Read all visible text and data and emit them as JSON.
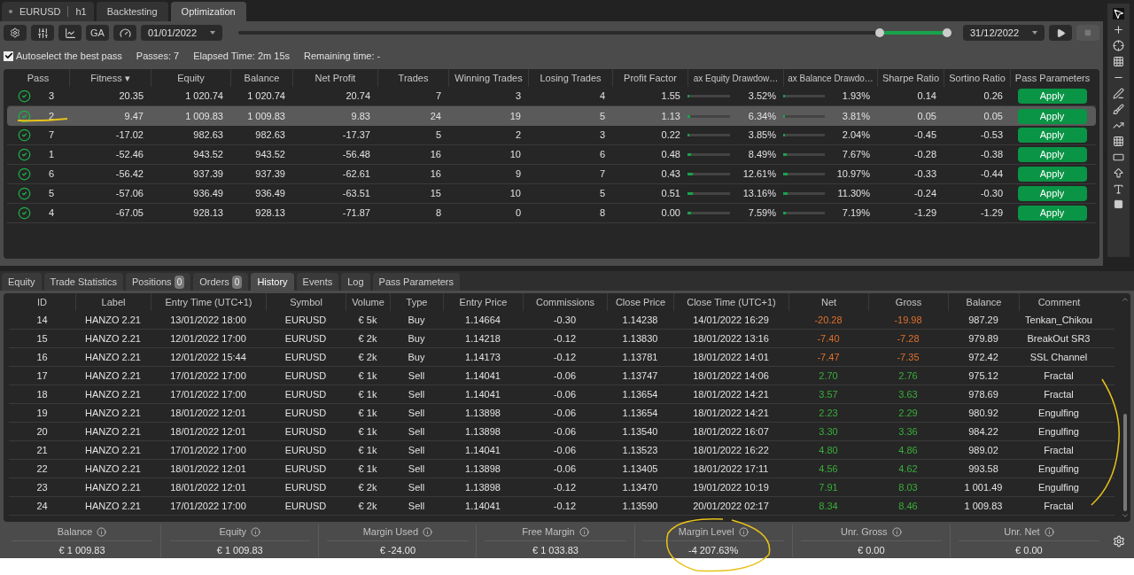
{
  "top_tabs": [
    {
      "kind": "symbol",
      "label": "EURUSD",
      "timeframe": "h1",
      "selected": false
    },
    {
      "kind": "plain",
      "label": "Backtesting",
      "selected": false
    },
    {
      "kind": "plain",
      "label": "Optimization",
      "selected": true
    }
  ],
  "toolbar": {
    "ga_label": "GA",
    "start_date": "01/01/2022",
    "end_date": "31/12/2022",
    "thumbs": [
      {
        "level": 0.905
      },
      {
        "level": 1.0
      }
    ],
    "stop_disabled": true
  },
  "options": {
    "autoselect": {
      "label": "Autoselect the best pass",
      "checked": true
    },
    "stats": [
      {
        "label": "Passes:",
        "value": "7"
      },
      {
        "label": "Elapsed Time:",
        "value": "2m 15s"
      },
      {
        "label": "Remaining time:",
        "value": "-"
      }
    ]
  },
  "passes": {
    "columns": [
      "Pass",
      "Fitness ▾",
      "Equity",
      "Balance",
      "Net Profit",
      "Trades",
      "Winning Trades",
      "Losing Trades",
      "Profit Factor",
      "ax Equity Drawdow…",
      "ax Balance Drawdo…",
      "Sharpe Ratio",
      "Sortino Ratio",
      "Pass Parameters"
    ],
    "rows": [
      {
        "pass": "3",
        "fitness": "20.35",
        "equity": "1 020.74",
        "balance": "1 020.74",
        "net_profit": "20.74",
        "trades": "7",
        "winning": "3",
        "losing": "4",
        "profit_factor": "1.55",
        "eq_dd": {
          "text": "3.52%",
          "level": 0.035
        },
        "bal_dd": {
          "text": "1.93%",
          "level": 0.019
        },
        "sharpe": "0.14",
        "sortino": "0.26",
        "action": "Apply",
        "selected": false
      },
      {
        "pass": "2",
        "fitness": "9.47",
        "equity": "1 009.83",
        "balance": "1 009.83",
        "net_profit": "9.83",
        "trades": "24",
        "winning": "19",
        "losing": "5",
        "profit_factor": "1.13",
        "eq_dd": {
          "text": "6.34%",
          "level": 0.063
        },
        "bal_dd": {
          "text": "3.81%",
          "level": 0.038
        },
        "sharpe": "0.05",
        "sortino": "0.05",
        "action": "Apply",
        "selected": true
      },
      {
        "pass": "7",
        "fitness": "-17.02",
        "equity": "982.63",
        "balance": "982.63",
        "net_profit": "-17.37",
        "trades": "5",
        "winning": "2",
        "losing": "3",
        "profit_factor": "0.22",
        "eq_dd": {
          "text": "3.85%",
          "level": 0.039
        },
        "bal_dd": {
          "text": "2.04%",
          "level": 0.02
        },
        "sharpe": "-0.45",
        "sortino": "-0.53",
        "action": "Apply",
        "selected": false
      },
      {
        "pass": "1",
        "fitness": "-52.46",
        "equity": "943.52",
        "balance": "943.52",
        "net_profit": "-56.48",
        "trades": "16",
        "winning": "10",
        "losing": "6",
        "profit_factor": "0.48",
        "eq_dd": {
          "text": "8.49%",
          "level": 0.085
        },
        "bal_dd": {
          "text": "7.67%",
          "level": 0.077
        },
        "sharpe": "-0.28",
        "sortino": "-0.38",
        "action": "Apply",
        "selected": false
      },
      {
        "pass": "6",
        "fitness": "-56.42",
        "equity": "937.39",
        "balance": "937.39",
        "net_profit": "-62.61",
        "trades": "16",
        "winning": "9",
        "losing": "7",
        "profit_factor": "0.43",
        "eq_dd": {
          "text": "12.61%",
          "level": 0.126
        },
        "bal_dd": {
          "text": "10.97%",
          "level": 0.11
        },
        "sharpe": "-0.33",
        "sortino": "-0.44",
        "action": "Apply",
        "selected": false
      },
      {
        "pass": "5",
        "fitness": "-57.06",
        "equity": "936.49",
        "balance": "936.49",
        "net_profit": "-63.51",
        "trades": "15",
        "winning": "10",
        "losing": "5",
        "profit_factor": "0.51",
        "eq_dd": {
          "text": "13.16%",
          "level": 0.132
        },
        "bal_dd": {
          "text": "11.30%",
          "level": 0.113
        },
        "sharpe": "-0.24",
        "sortino": "-0.30",
        "action": "Apply",
        "selected": false
      },
      {
        "pass": "4",
        "fitness": "-67.05",
        "equity": "928.13",
        "balance": "928.13",
        "net_profit": "-71.87",
        "trades": "8",
        "winning": "0",
        "losing": "8",
        "profit_factor": "0.00",
        "eq_dd": {
          "text": "7.59%",
          "level": 0.076
        },
        "bal_dd": {
          "text": "7.19%",
          "level": 0.072
        },
        "sharpe": "-1.29",
        "sortino": "-1.29",
        "action": "Apply",
        "selected": false
      }
    ]
  },
  "bottom_tabs": [
    {
      "label": "Equity",
      "selected": false
    },
    {
      "label": "Trade Statistics",
      "selected": false
    },
    {
      "label": "Positions",
      "badge": "0",
      "selected": false
    },
    {
      "label": "Orders",
      "badge": "0",
      "selected": false
    },
    {
      "label": "History",
      "selected": true
    },
    {
      "label": "Events",
      "selected": false
    },
    {
      "label": "Log",
      "selected": false
    },
    {
      "label": "Pass Parameters",
      "selected": false
    }
  ],
  "history": {
    "columns": [
      "ID",
      "Label",
      "Entry Time (UTC+1)",
      "Symbol",
      "Volume",
      "Type",
      "Entry Price",
      "Commissions",
      "Close Price",
      "Close Time (UTC+1)",
      "Net",
      "Gross",
      "Balance",
      "Comment"
    ],
    "rows": [
      {
        "cells": [
          "14",
          "HANZO 2.21",
          "13/01/2022 18:00",
          "EURUSD",
          "€ 5k",
          "Buy",
          "1.14664",
          "-0.30",
          "1.14238",
          "14/01/2022 16:29",
          "-20.28",
          "-19.98",
          "987.29",
          "Tenkan_Chikou"
        ],
        "color": "#e0702a"
      },
      {
        "cells": [
          "15",
          "HANZO 2.21",
          "12/01/2022 17:00",
          "EURUSD",
          "€ 2k",
          "Buy",
          "1.14218",
          "-0.12",
          "1.13830",
          "18/01/2022 13:16",
          "-7.40",
          "-7.28",
          "979.89",
          "BreakOut SR3"
        ],
        "color": "#e0702a"
      },
      {
        "cells": [
          "16",
          "HANZO 2.21",
          "12/01/2022 15:44",
          "EURUSD",
          "€ 2k",
          "Buy",
          "1.14173",
          "-0.12",
          "1.13781",
          "18/01/2022 14:01",
          "-7.47",
          "-7.35",
          "972.42",
          "SSL Channel"
        ],
        "color": "#e0702a"
      },
      {
        "cells": [
          "17",
          "HANZO 2.21",
          "17/01/2022 17:00",
          "EURUSD",
          "€ 1k",
          "Sell",
          "1.14041",
          "-0.06",
          "1.13747",
          "18/01/2022 14:06",
          "2.70",
          "2.76",
          "975.12",
          "Fractal"
        ],
        "color": "#3aae3a"
      },
      {
        "cells": [
          "18",
          "HANZO 2.21",
          "17/01/2022 17:00",
          "EURUSD",
          "€ 1k",
          "Sell",
          "1.14041",
          "-0.06",
          "1.13654",
          "18/01/2022 14:21",
          "3.57",
          "3.63",
          "978.69",
          "Fractal"
        ],
        "color": "#3aae3a"
      },
      {
        "cells": [
          "19",
          "HANZO 2.21",
          "18/01/2022 12:01",
          "EURUSD",
          "€ 1k",
          "Sell",
          "1.13898",
          "-0.06",
          "1.13654",
          "18/01/2022 14:21",
          "2.23",
          "2.29",
          "980.92",
          "Engulfing"
        ],
        "color": "#3aae3a"
      },
      {
        "cells": [
          "20",
          "HANZO 2.21",
          "18/01/2022 12:01",
          "EURUSD",
          "€ 1k",
          "Sell",
          "1.13898",
          "-0.06",
          "1.13540",
          "18/01/2022 16:07",
          "3.30",
          "3.36",
          "984.22",
          "Engulfing"
        ],
        "color": "#3aae3a"
      },
      {
        "cells": [
          "21",
          "HANZO 2.21",
          "17/01/2022 17:00",
          "EURUSD",
          "€ 1k",
          "Sell",
          "1.14041",
          "-0.06",
          "1.13523",
          "18/01/2022 16:22",
          "4.80",
          "4.86",
          "989.02",
          "Fractal"
        ],
        "color": "#3aae3a"
      },
      {
        "cells": [
          "22",
          "HANZO 2.21",
          "18/01/2022 12:01",
          "EURUSD",
          "€ 1k",
          "Sell",
          "1.13898",
          "-0.06",
          "1.13405",
          "18/01/2022 17:11",
          "4.56",
          "4.62",
          "993.58",
          "Engulfing"
        ],
        "color": "#3aae3a"
      },
      {
        "cells": [
          "23",
          "HANZO 2.21",
          "18/01/2022 12:01",
          "EURUSD",
          "€ 2k",
          "Sell",
          "1.13898",
          "-0.12",
          "1.13470",
          "19/01/2022 10:19",
          "7.91",
          "8.03",
          "1 001.49",
          "Engulfing"
        ],
        "color": "#3aae3a"
      },
      {
        "cells": [
          "24",
          "HANZO 2.21",
          "17/01/2022 17:00",
          "EURUSD",
          "€ 2k",
          "Sell",
          "1.14041",
          "-0.12",
          "1.13590",
          "20/01/2022 02:17",
          "8.34",
          "8.46",
          "1 009.83",
          "Fractal"
        ],
        "color": "#3aae3a"
      }
    ]
  },
  "summary": [
    {
      "label": "Balance",
      "value": "€ 1 009.83"
    },
    {
      "label": "Equity",
      "value": "€ 1 009.83"
    },
    {
      "label": "Margin Used",
      "value": "€ -24.00"
    },
    {
      "label": "Free Margin",
      "value": "€ 1 033.83"
    },
    {
      "label": "Margin Level",
      "value": "-4 207.63%"
    },
    {
      "label": "Unr. Gross",
      "value": "€ 0.00"
    },
    {
      "label": "Unr. Net",
      "value": "€ 0.00"
    }
  ]
}
